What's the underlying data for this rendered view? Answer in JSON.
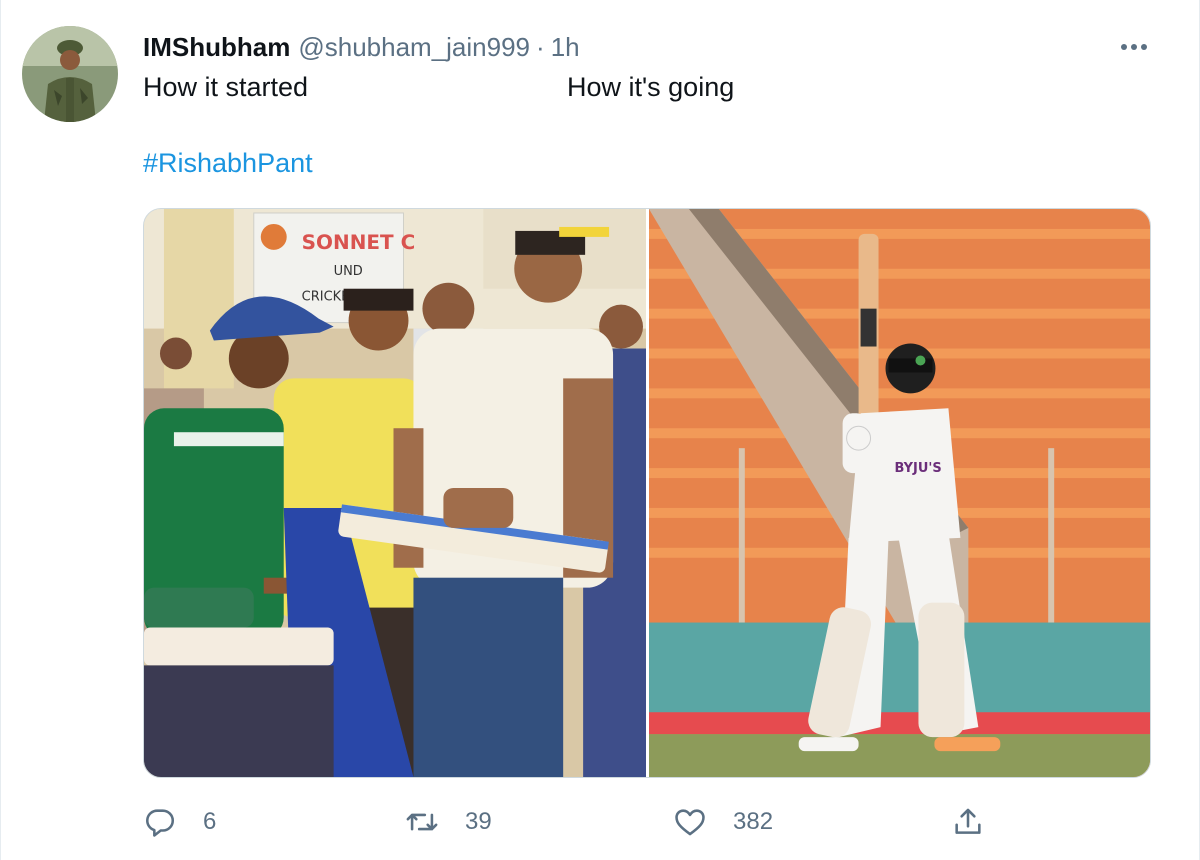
{
  "tweet": {
    "display_name": "IMShubham",
    "handle": "@shubham_jain999",
    "separator": "·",
    "time": "1h",
    "text_left": "How it started",
    "text_right": "How it's going",
    "hashtag": "#RishabhPant"
  },
  "media": {
    "left_banner_text": "SONNET C",
    "left_banner_sub1": "UND",
    "left_banner_sub2": "CRICKET",
    "right_jersey_text": "BYJU'S"
  },
  "actions": {
    "reply_count": "6",
    "retweet_count": "39",
    "like_count": "382"
  },
  "colors": {
    "hashtag": "#1b95e0",
    "secondary_text": "#5b7083",
    "primary_text": "#0f1419"
  },
  "icons": [
    "avatar-photo",
    "more-options-icon",
    "reply-icon",
    "retweet-icon",
    "like-icon",
    "share-icon"
  ]
}
